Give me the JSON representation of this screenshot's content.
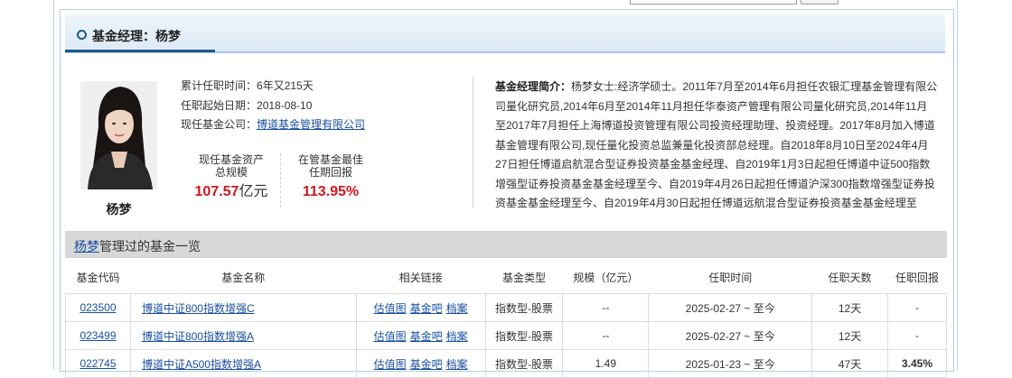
{
  "header": {
    "title": "基金经理：杨梦"
  },
  "manager": {
    "name": "杨梦",
    "tenure_label": "累计任职时间：",
    "tenure_value": "6年又215天",
    "start_label": "任职起始日期：",
    "start_value": "2018-08-10",
    "company_label": "现任基金公司：",
    "company_value": "博道基金管理有限公司"
  },
  "stats": {
    "assets_label1": "现任基金资产",
    "assets_label2": "总规模",
    "assets_value": "107.57",
    "assets_unit": "亿元",
    "best_label1": "在管基金最佳",
    "best_label2": "任期回报",
    "best_value": "113.95%"
  },
  "bio": {
    "label": "基金经理简介：",
    "text": "杨梦女士:经济学硕士。2011年7月至2014年6月担任农银汇理基金管理有限公司量化研究员,2014年6月至2014年11月担任华泰资产管理有限公司量化研究员,2014年11月至2017年7月担任上海博道投资管理有限公司投资经理助理、投资经理。2017年8月加入博道基金管理有限公司,现任量化投资总监兼量化投资部总经理。自2018年8月10日至2024年4月27日担任博道启航混合型证券投资基金基金经理、自2019年1月3日起担任博道中证500指数增强型证券投资基金基金经理至今、自2019年4月26日起担任博道沪深300指数增强型证券投资基金基金经理至今、自2019年4月30日起担任博道远航混合型证券投资基金基金经理至"
  },
  "table": {
    "title_link": "杨梦",
    "title_rest": "管理过的基金一览",
    "headers": [
      "基金代码",
      "基金名称",
      "相关链接",
      "基金类型",
      "规模（亿元）",
      "任职时间",
      "任职天数",
      "任职回报"
    ],
    "link_labels": [
      "估值图",
      "基金吧",
      "档案"
    ],
    "rows": [
      {
        "code": "023500",
        "name": "博道中证800指数增强C",
        "type": "指数型-股票",
        "scale": "--",
        "period": "2025-02-27 ~ 至今",
        "days": "12天",
        "ret": "-"
      },
      {
        "code": "023499",
        "name": "博道中证800指数增强A",
        "type": "指数型-股票",
        "scale": "--",
        "period": "2025-02-27 ~ 至今",
        "days": "12天",
        "ret": "-"
      },
      {
        "code": "022745",
        "name": "博道中证A500指数增强A",
        "type": "指数型-股票",
        "scale": "1.49",
        "period": "2025-01-23 ~ 至今",
        "days": "47天",
        "ret": "3.45%"
      }
    ]
  }
}
